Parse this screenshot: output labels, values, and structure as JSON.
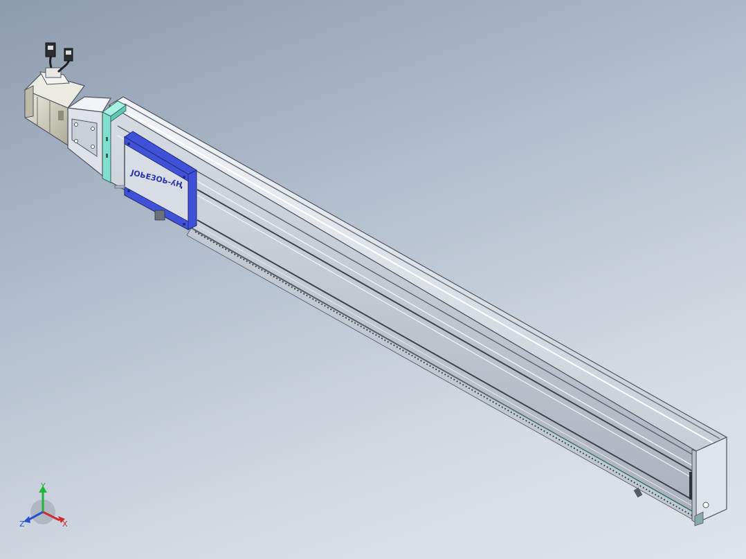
{
  "viewport": {
    "background_top": "#8d9bae",
    "background_bottom": "#dfe4ea"
  },
  "model": {
    "carriage_logo_text": "ЈОЬЕЗОЬ-ʎҢ",
    "colors": {
      "profile": "#c9cfd8",
      "profile_shadow": "#aeb6c2",
      "end_plate": "#7fe0d0",
      "carriage_accent": "#3f51d6",
      "motor_body": "#d8d6c4"
    }
  },
  "triad": {
    "y_label": "Y",
    "x_label": "X",
    "z_label": "Z",
    "y_color": "#1fb53a",
    "x_color": "#d12a2a",
    "z_color": "#2a4fd1"
  }
}
